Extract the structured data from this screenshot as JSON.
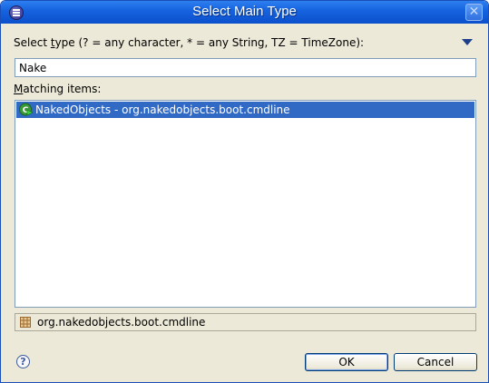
{
  "window": {
    "title": "Select Main Type",
    "close_symbol": "✕",
    "icon": "eclipse-app-icon"
  },
  "prompt": {
    "label_pre": "Select ",
    "label_mnemonic": "t",
    "label_post": "ype (? = any character, * = any String, TZ = TimeZone):",
    "menu_icon": "dropdown-triangle-icon"
  },
  "search": {
    "value": "Nake"
  },
  "matching": {
    "label_mnemonic": "M",
    "label_rest": "atching items:",
    "items": [
      {
        "label": "NakedObjects - org.nakedobjects.boot.cmdline",
        "icon": "class-with-main-icon",
        "selected": true
      }
    ]
  },
  "details": {
    "package": "org.nakedobjects.boot.cmdline",
    "icon": "package-icon"
  },
  "buttons": {
    "help_symbol": "?",
    "ok": "OK",
    "cancel": "Cancel"
  },
  "colors": {
    "title_bar": "#0b4fcc",
    "selection": "#316ac5",
    "dialog_bg": "#ece9d8"
  }
}
